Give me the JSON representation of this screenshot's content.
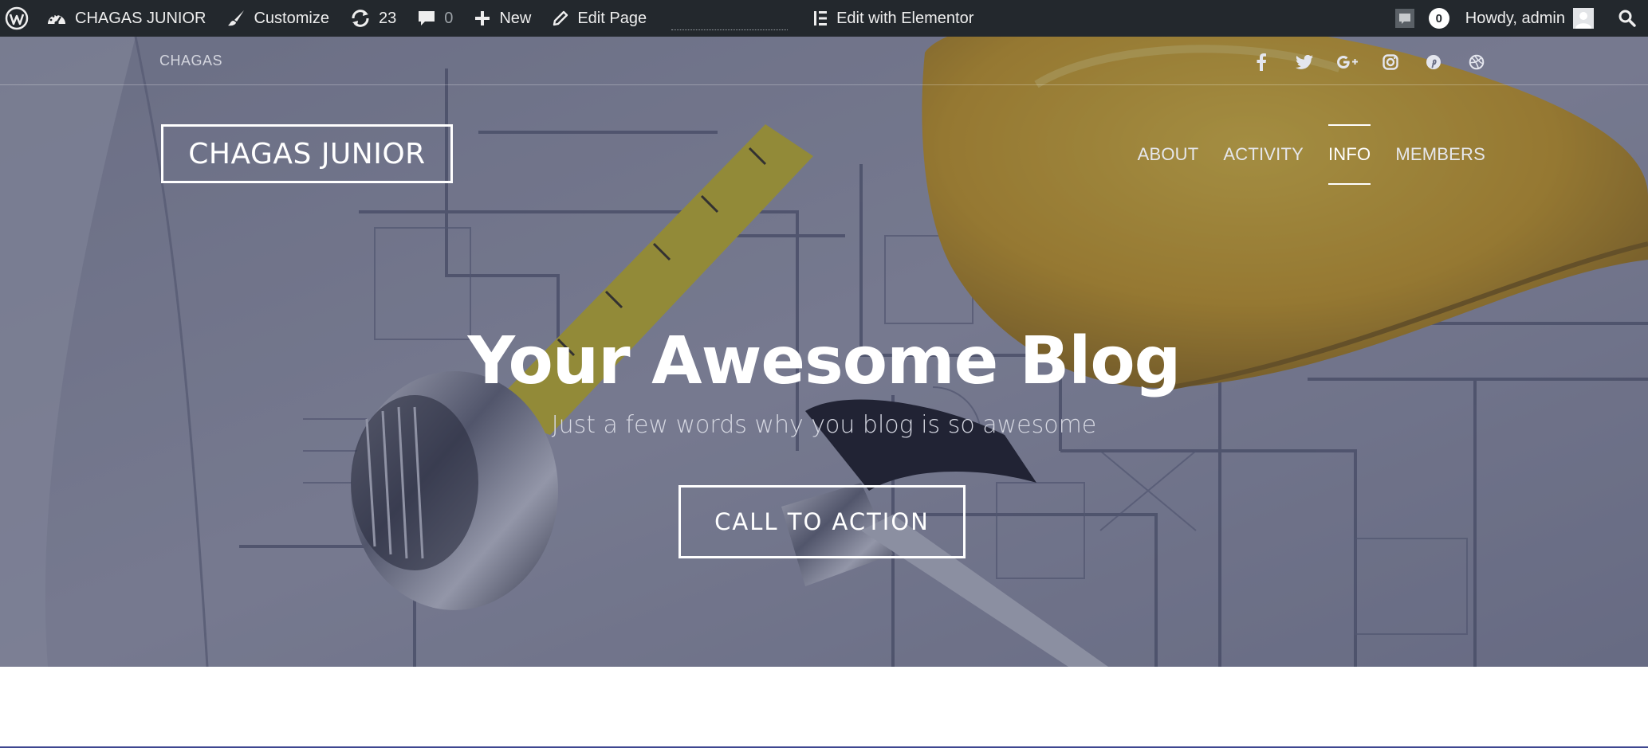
{
  "admin_bar": {
    "site_name": "CHAGAS JUNIOR",
    "customize": "Customize",
    "updates_count": "23",
    "comments_count": "0",
    "new_label": "New",
    "edit_page": "Edit Page",
    "edit_elementor": "Edit with Elementor",
    "notifications_count": "0",
    "greeting": "Howdy, admin",
    "colors": {
      "bg": "#23282d",
      "text": "#eeeeee"
    },
    "icons": [
      "wordpress-logo-icon",
      "dashboard-icon",
      "brush-icon",
      "refresh-icon",
      "comment-icon",
      "plus-icon",
      "pencil-icon",
      "elementor-icon",
      "notification-icon",
      "avatar",
      "search-icon"
    ]
  },
  "header": {
    "topbar_text": "CHAGAS",
    "social_icons": [
      "facebook-icon",
      "twitter-icon",
      "google-plus-icon",
      "instagram-icon",
      "pinterest-icon",
      "dribbble-icon"
    ],
    "logo": "CHAGAS JUNIOR",
    "nav": [
      {
        "label": "ABOUT",
        "active": false
      },
      {
        "label": "ACTIVITY",
        "active": false
      },
      {
        "label": "INFO",
        "active": true
      },
      {
        "label": "MEMBERS",
        "active": false
      }
    ]
  },
  "hero": {
    "title": "Your Awesome Blog",
    "subtitle": "Just a few words why you blog is so awesome",
    "cta_label": "CALL TO ACTION",
    "colors": {
      "overlay": "#282d4e",
      "helmet": "#e8b92a",
      "tape": "#d9c72a"
    }
  }
}
